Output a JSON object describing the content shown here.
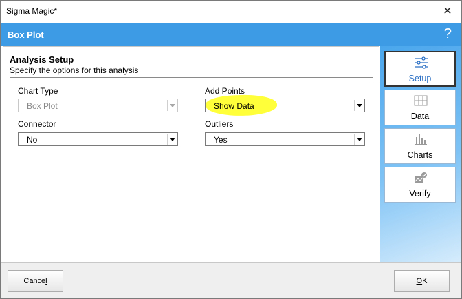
{
  "window": {
    "title": "Sigma Magic*",
    "close_glyph": "✕"
  },
  "header": {
    "title": "Box Plot",
    "help_glyph": "?"
  },
  "section": {
    "title": "Analysis Setup",
    "subtitle": "Specify the options for this analysis"
  },
  "fields": {
    "chart_type": {
      "label": "Chart Type",
      "value": "Box Plot",
      "disabled": true
    },
    "add_points": {
      "label": "Add Points",
      "value": "Show Data"
    },
    "connector": {
      "label": "Connector",
      "value": "No"
    },
    "outliers": {
      "label": "Outliers",
      "value": "Yes"
    }
  },
  "sidebar": {
    "items": [
      {
        "label": "Setup",
        "icon": "sliders-icon",
        "active": true
      },
      {
        "label": "Data",
        "icon": "table-icon"
      },
      {
        "label": "Charts",
        "icon": "bar-chart-icon"
      },
      {
        "label": "Verify",
        "icon": "verify-icon"
      }
    ]
  },
  "footer": {
    "cancel": {
      "prefix": "Cance",
      "underlined": "l"
    },
    "ok": {
      "prefix": "",
      "underlined": "O",
      "suffix": "K"
    }
  },
  "colors": {
    "header": "#3d9be6",
    "highlight": "#ffff3a",
    "active_label": "#2a6fc4"
  }
}
